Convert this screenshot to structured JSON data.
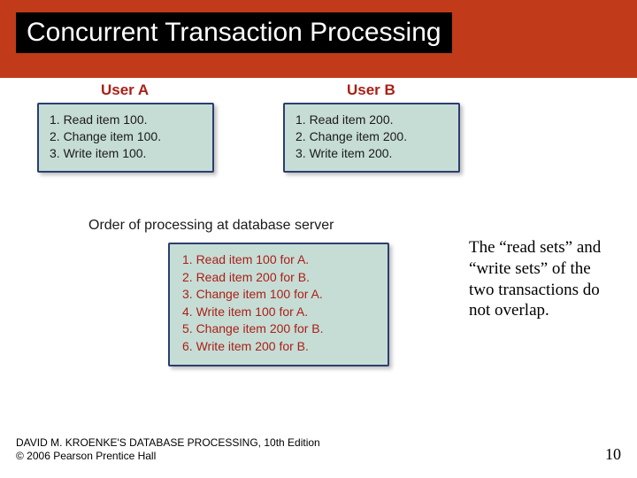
{
  "slide": {
    "title": "Concurrent Transaction Processing",
    "userA": {
      "label": "User A",
      "steps": [
        "1. Read item 100.",
        "2. Change item 100.",
        "3. Write item 100."
      ]
    },
    "userB": {
      "label": "User B",
      "steps": [
        "1. Read item 200.",
        "2. Change item 200.",
        "3. Write item 200."
      ]
    },
    "server": {
      "caption": "Order of processing at database server",
      "steps": [
        "1. Read item 100 for A.",
        "2. Read item 200 for B.",
        "3. Change item 100 for A.",
        "4. Write item 100 for A.",
        "5. Change item 200 for B.",
        "6. Write item 200 for B."
      ]
    },
    "annotation": "The “read sets” and “write sets” of the two transactions do not overlap.",
    "footer": {
      "line1": "DAVID M. KROENKE'S DATABASE PROCESSING, 10th Edition",
      "line2": "© 2006 Pearson Prentice Hall",
      "pageNumber": "10"
    }
  }
}
